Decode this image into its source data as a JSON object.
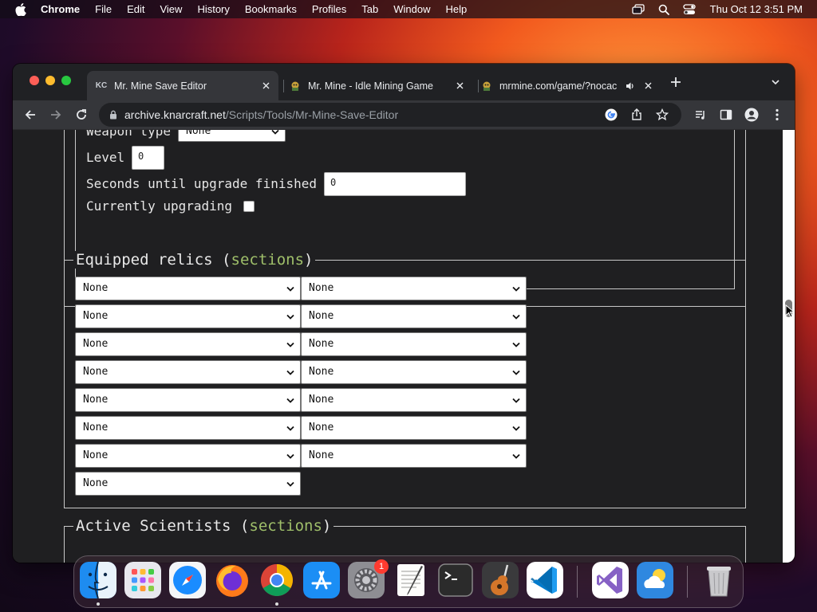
{
  "menubar": {
    "app_name": "Chrome",
    "items": [
      "File",
      "Edit",
      "View",
      "History",
      "Bookmarks",
      "Profiles",
      "Tab",
      "Window",
      "Help"
    ],
    "clock": "Thu Oct 12  3:51 PM"
  },
  "browser": {
    "tabs": [
      {
        "favicon_text": "KC",
        "title": "Mr. Mine Save Editor",
        "active": true
      },
      {
        "favicon_text": "",
        "title": "Mr. Mine - Idle Mining Game",
        "active": false
      },
      {
        "favicon_text": "",
        "title": "mrmine.com/game/?nocac",
        "active": false
      }
    ],
    "url_host": "archive.knarcraft.net",
    "url_path": "/Scripts/Tools/Mr-Mine-Save-Editor"
  },
  "page": {
    "weapon_type_label": "Weapon type",
    "weapon_type_value": "None",
    "level_label": "Level",
    "level_value": "0",
    "seconds_label": "Seconds until upgrade finished",
    "seconds_value": "0",
    "currently_upgrading_label": "Currently upgrading",
    "relics_legend": "Equipped relics",
    "relics_link": "sections",
    "relic_slots": [
      "None",
      "None",
      "None",
      "None",
      "None",
      "None",
      "None",
      "None",
      "None",
      "None",
      "None",
      "None",
      "None",
      "None",
      "None"
    ],
    "scientists_legend": "Active Scientists",
    "scientists_link": "sections",
    "paren_open": "(",
    "paren_close": ")"
  },
  "dock": {
    "apps": [
      "finder-icon",
      "launchpad-icon",
      "safari-icon",
      "firefox-icon",
      "chrome-icon",
      "app-store-icon",
      "system-settings-icon",
      "textedit-icon",
      "terminal-icon",
      "garageband-icon",
      "vscode-icon",
      "visual-studio-icon",
      "weather-icon",
      "trash-icon"
    ],
    "settings_badge": "1"
  },
  "colors": {
    "link": "#9fbf6a",
    "page_bg": "#1f1f21",
    "tab_active": "#35363a"
  }
}
